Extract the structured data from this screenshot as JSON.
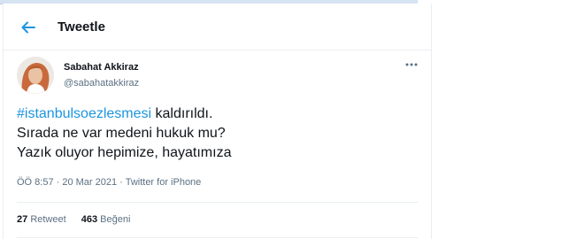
{
  "header": {
    "title": "Tweetle",
    "back_icon": "arrow-left-icon"
  },
  "tweet": {
    "author": {
      "name": "Sabahat Akkiraz",
      "handle": "@sabahatakkiraz"
    },
    "hashtag": "#istanbulsoezlesmesi",
    "line1_rest": " kaldırıldı.",
    "line2": "Sırada ne var medeni hukuk mu?",
    "line3": "Yazık oluyor hepimize, hayatımıza",
    "timestamp": "ÖÖ 8:57 · 20 Mar 2021",
    "separator": " · ",
    "source": "Twitter for iPhone",
    "stats": {
      "retweets_count": "27",
      "retweets_label": "Retweet",
      "likes_count": "463",
      "likes_label": "Beğeni"
    }
  },
  "colors": {
    "accent": "#1b95e0",
    "text": "#0f1419",
    "muted": "#5b7083"
  }
}
